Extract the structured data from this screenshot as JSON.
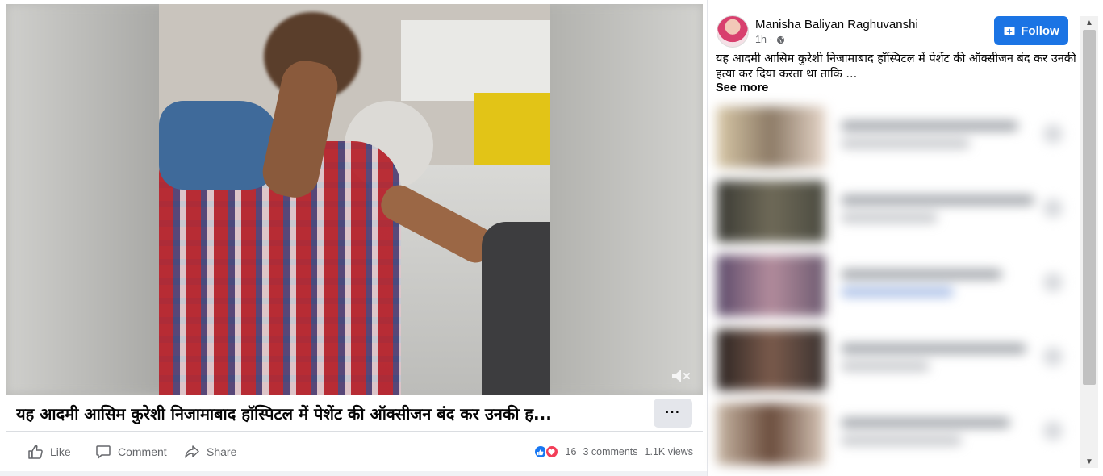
{
  "video": {
    "mute_label": "Muted"
  },
  "post": {
    "title": "यह आदमी आसिम कुरेशी निजामाबाद हॉस्पिटल में पेशेंट की ऑक्सीजन बंद कर उनकी ह...",
    "more_label": "···",
    "actions": {
      "like": "Like",
      "comment": "Comment",
      "share": "Share"
    },
    "stats": {
      "reaction_count": "16",
      "comments": "3 comments",
      "views": "1.1K views"
    }
  },
  "sidebar": {
    "author": "Manisha Baliyan Raghuvanshi",
    "time": "1h ·",
    "follow_label": "Follow",
    "text": "यह आदमी आसिम कुरेशी निजामाबाद हॉस्पिटल में पेशेंट की ऑक्सीजन बंद कर उनकी हत्या कर दिया करता था ताकि ...",
    "see_more": "See more"
  },
  "colors": {
    "accent": "#1b74e4",
    "like_reaction": "#1877f2",
    "love_reaction": "#f33e58",
    "muted_text": "#65676b"
  }
}
